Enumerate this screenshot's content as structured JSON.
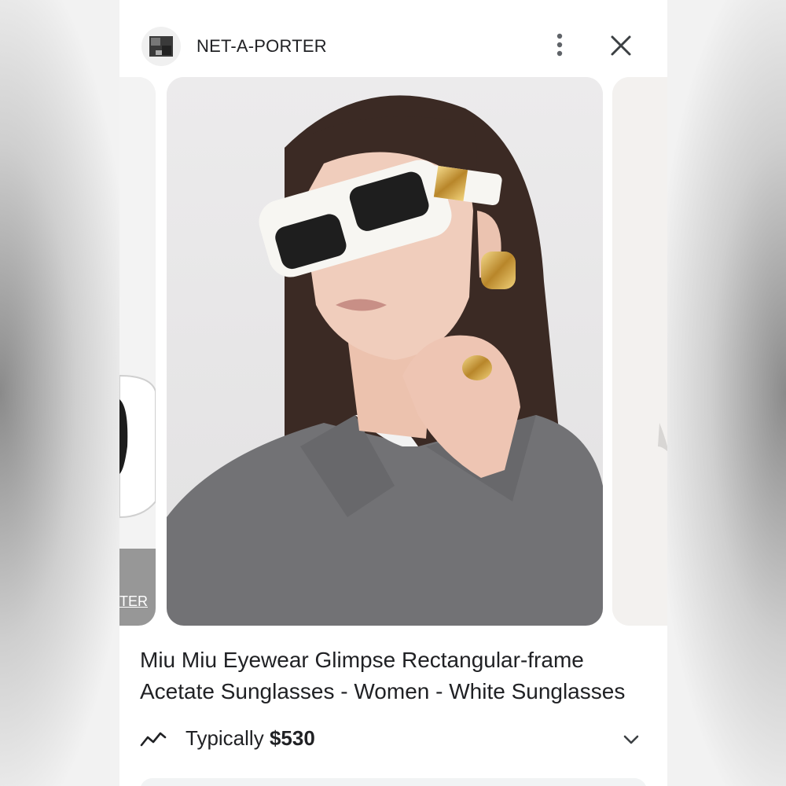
{
  "header": {
    "site_name": "NET-A-PORTER",
    "icons": {
      "more": "more-vert-icon",
      "close": "close-icon"
    }
  },
  "carousel": {
    "prev_caption": "TER",
    "main_alt": "Model wearing white rectangular sunglasses with gold temples"
  },
  "product": {
    "title": "Miu Miu Eyewear Glimpse Rectangular-frame Acetate Sunglasses - Women - White Sunglasses",
    "price_prefix": "Typically",
    "price_amount": "$530",
    "icons": {
      "trend": "price-trend-icon",
      "expand": "chevron-down-icon"
    }
  },
  "colors": {
    "text": "#202124",
    "panel": "#ffffff",
    "muted_bg": "#f1f3f4"
  }
}
